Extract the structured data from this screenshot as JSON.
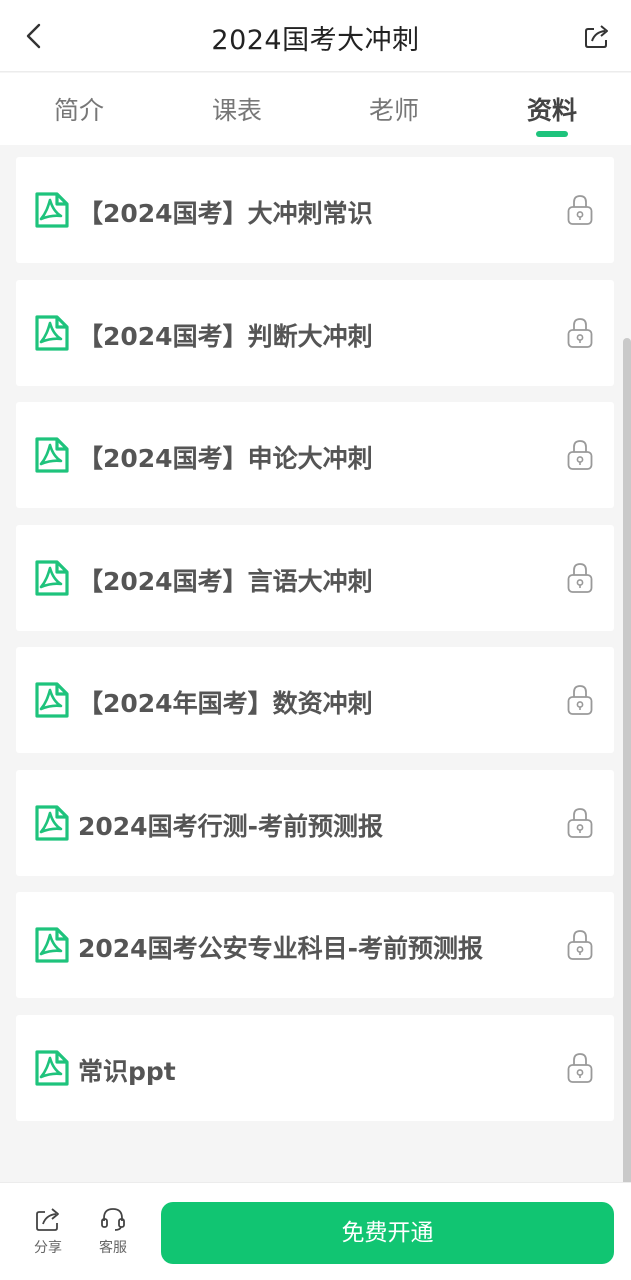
{
  "header": {
    "title": "2024国考大冲刺",
    "back_icon": "chevron-left-icon",
    "share_icon": "share-icon"
  },
  "tabs": [
    {
      "label": "简介",
      "active": false
    },
    {
      "label": "课表",
      "active": false
    },
    {
      "label": "老师",
      "active": false
    },
    {
      "label": "资料",
      "active": true
    }
  ],
  "materials": [
    {
      "title": "【2024国考】大冲刺常识",
      "icon": "pdf-icon",
      "locked": true
    },
    {
      "title": "【2024国考】判断大冲刺",
      "icon": "pdf-icon",
      "locked": true
    },
    {
      "title": "【2024国考】申论大冲刺",
      "icon": "pdf-icon",
      "locked": true
    },
    {
      "title": "【2024国考】言语大冲刺",
      "icon": "pdf-icon",
      "locked": true
    },
    {
      "title": "【2024年国考】数资冲刺",
      "icon": "pdf-icon",
      "locked": true
    },
    {
      "title": "2024国考行测-考前预测报",
      "icon": "pdf-icon",
      "locked": true
    },
    {
      "title": "2024国考公安专业科目-考前预测报",
      "icon": "pdf-icon",
      "locked": true
    },
    {
      "title": "常识ppt",
      "icon": "pdf-icon",
      "locked": true
    }
  ],
  "bottom": {
    "share_label": "分享",
    "service_label": "客服",
    "cta_label": "免费开通"
  },
  "colors": {
    "accent": "#11c572",
    "pdf_green": "#1ec37c",
    "background": "#f5f5f5"
  }
}
